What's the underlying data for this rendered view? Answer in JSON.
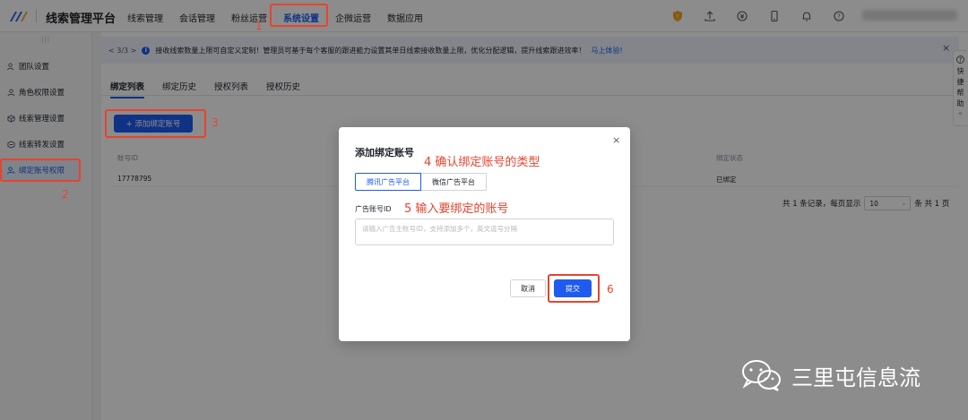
{
  "topbar": {
    "app_title": "线索管理平台",
    "nav": [
      "线索管理",
      "会话管理",
      "粉丝运营",
      "系统设置",
      "企微运营",
      "数据应用"
    ],
    "active_nav_index": 3
  },
  "sidebar": {
    "items": [
      "团队设置",
      "角色权限设置",
      "线索管理设置",
      "线索转发设置",
      "绑定账号权限"
    ],
    "active_index": 4
  },
  "notice": {
    "pager": "< 3/3 >",
    "text": "接收线索数量上限可自定义定制！管理员可基于每个客服的跟进能力设置其单日线索接收数量上限，优化分配逻辑，提升线索跟进效率！",
    "link": "马上体验!",
    "close": "×"
  },
  "tabs": [
    "绑定列表",
    "绑定历史",
    "授权列表",
    "授权历史"
  ],
  "add_button": "+ 添加绑定账号",
  "table": {
    "headers": [
      "账号ID",
      "绑定状态"
    ],
    "rows": [
      {
        "account_id": "17778795",
        "status": "已绑定"
      }
    ]
  },
  "pagination": {
    "summary": "共 1 条记录，每页显示",
    "page_size": "10",
    "total_pages": "条 共 1 页"
  },
  "help_tab": {
    "label": [
      "快",
      "捷",
      "帮",
      "助"
    ],
    "icon": "?"
  },
  "modal": {
    "title": "添加绑定账号",
    "close": "×",
    "platform_options": [
      "腾讯广告平台",
      "微信广告平台"
    ],
    "selected_platform_index": 0,
    "field_label": "广告账号ID",
    "placeholder": "请输入广告主账号ID，支持添加多个，英文逗号分隔",
    "cancel": "取消",
    "submit": "提交"
  },
  "annotations": {
    "n1": "1",
    "n2": "2",
    "n3": "3",
    "n4": "4 确认绑定账号的类型",
    "n5": "5 输入要绑定的账号",
    "n6": "6",
    "color": "#e8432e"
  },
  "watermark": {
    "text": "三里屯信息流"
  },
  "colors": {
    "primary": "#1e5bf0",
    "annotation": "#e8432e"
  }
}
